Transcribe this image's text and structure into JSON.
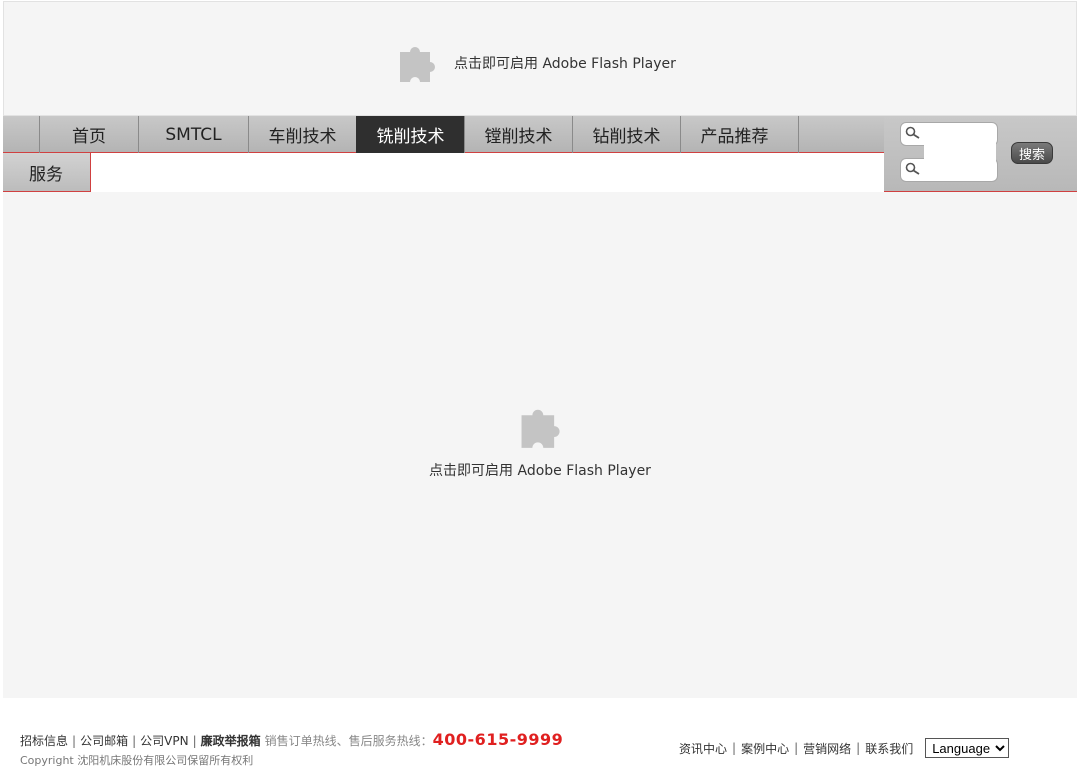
{
  "flash": {
    "prompt_top": "点击即可启用 Adobe Flash Player",
    "prompt_main": "点击即可启用 Adobe Flash Player"
  },
  "nav": {
    "items": [
      {
        "label": "首页",
        "active": false
      },
      {
        "label": "SMTCL",
        "active": false
      },
      {
        "label": "车削技术",
        "active": false
      },
      {
        "label": "铣削技术",
        "active": true
      },
      {
        "label": "镗削技术",
        "active": false
      },
      {
        "label": "钻削技术",
        "active": false
      },
      {
        "label": "产品推荐",
        "active": false
      }
    ],
    "service": "服务"
  },
  "search": {
    "button": "搜索",
    "placeholder": ""
  },
  "footer": {
    "links_left": [
      "招标信息",
      "公司邮箱",
      "公司VPN",
      "廉政举报箱"
    ],
    "hotline_text": "销售订单热线、售后服务热线：",
    "hotline_number": "400-615-9999",
    "copyright": "Copyright 沈阳机床股份有限公司保留所有权利",
    "links_right": [
      "资讯中心",
      "案例中心",
      "营销网络",
      "联系我们"
    ],
    "language_selected": "Language",
    "separator": "|"
  },
  "colors": {
    "accent_red": "#e02020",
    "nav_active_bg": "#2f2f2f",
    "nav_bg": "#c0c0c0",
    "flash_bg": "#f5f5f5"
  }
}
